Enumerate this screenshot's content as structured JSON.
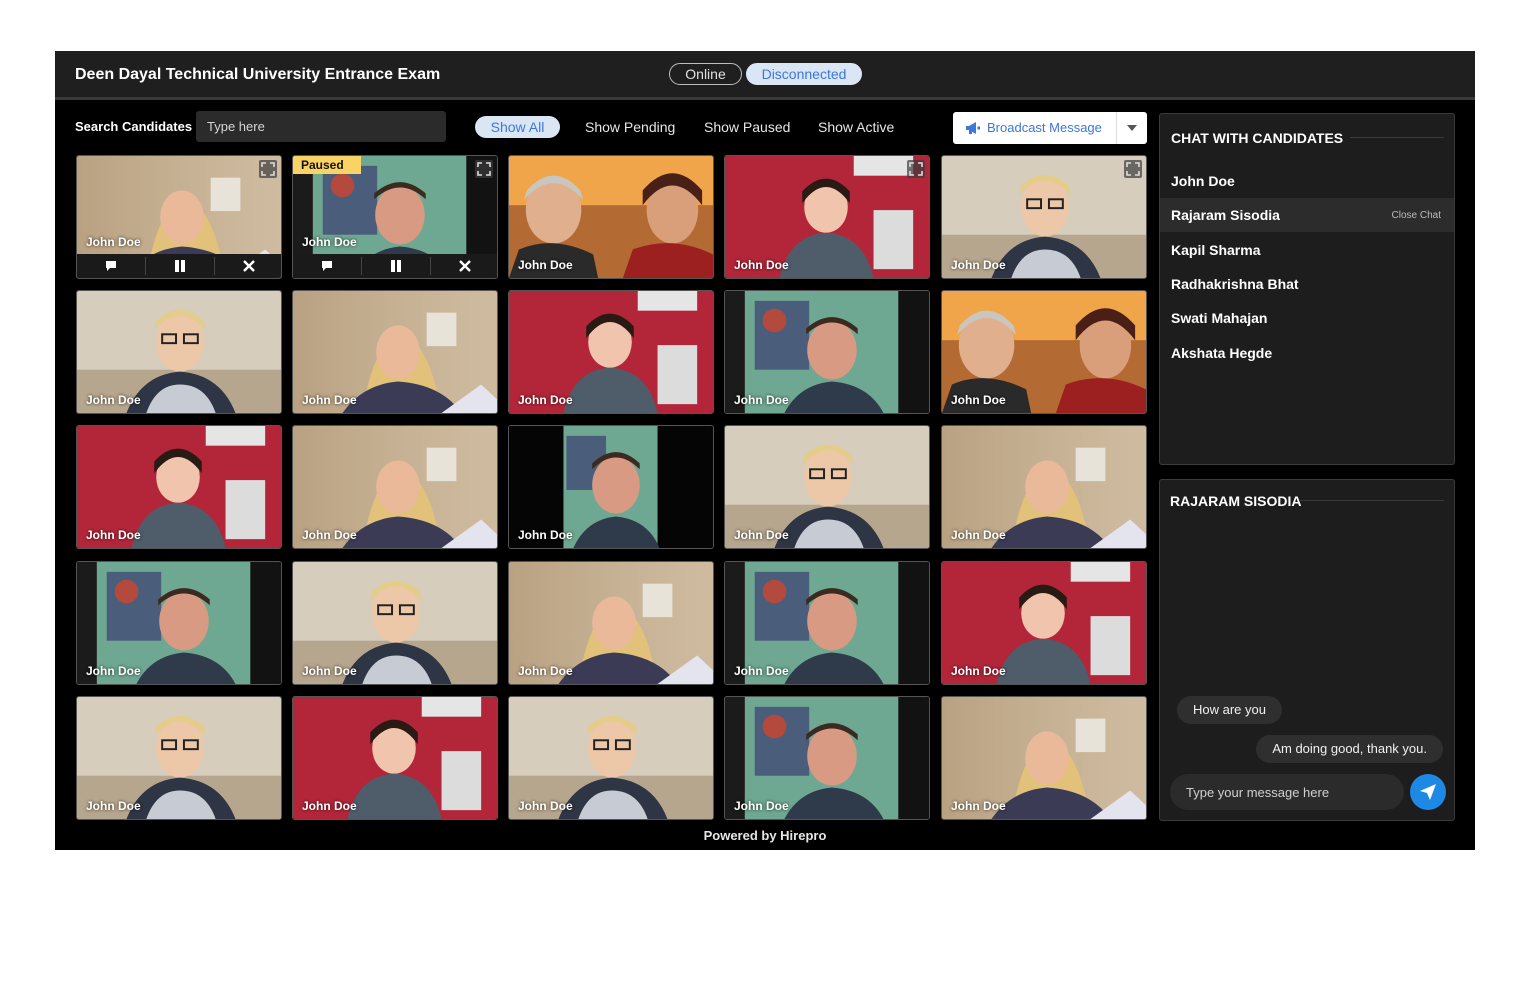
{
  "header": {
    "title": "Deen Dayal Technical University Entrance Exam",
    "status_online": "Online",
    "status_disconnected": "Disconnected"
  },
  "toolbar": {
    "search_label": "Search Candidates",
    "search_placeholder": "Type here",
    "filters": [
      "Show All",
      "Show Pending",
      "Show Paused",
      "Show Active"
    ],
    "broadcast_label": "Broadcast Message"
  },
  "grid": {
    "paused_label": "Paused",
    "tiles": [
      {
        "name": "John Doe",
        "scene": "blonde"
      },
      {
        "name": "John Doe",
        "scene": "green",
        "paused": true
      },
      {
        "name": "John Doe",
        "scene": "orange"
      },
      {
        "name": "John Doe",
        "scene": "red"
      },
      {
        "name": "John Doe",
        "scene": "glasses"
      },
      {
        "name": "John Doe",
        "scene": "glasses"
      },
      {
        "name": "John Doe",
        "scene": "blonde"
      },
      {
        "name": "John Doe",
        "scene": "red"
      },
      {
        "name": "John Doe",
        "scene": "green"
      },
      {
        "name": "John Doe",
        "scene": "orange"
      },
      {
        "name": "John Doe",
        "scene": "red"
      },
      {
        "name": "John Doe",
        "scene": "blonde"
      },
      {
        "name": "John Doe",
        "scene": "dark"
      },
      {
        "name": "John Doe",
        "scene": "glasses"
      },
      {
        "name": "John Doe",
        "scene": "blonde"
      },
      {
        "name": "John Doe",
        "scene": "green"
      },
      {
        "name": "John Doe",
        "scene": "glasses"
      },
      {
        "name": "John Doe",
        "scene": "blonde"
      },
      {
        "name": "John Doe",
        "scene": "green"
      },
      {
        "name": "John Doe",
        "scene": "red"
      },
      {
        "name": "John Doe",
        "scene": "glasses"
      },
      {
        "name": "John Doe",
        "scene": "red"
      },
      {
        "name": "John Doe",
        "scene": "glasses"
      },
      {
        "name": "John Doe",
        "scene": "green"
      },
      {
        "name": "John Doe",
        "scene": "blonde"
      }
    ]
  },
  "chat_list": {
    "title": "CHAT WITH CANDIDATES",
    "close_label": "Close Chat",
    "selected": 1,
    "candidates": [
      "John Doe",
      "Rajaram Sisodia",
      "Kapil Sharma",
      "Radhakrishna Bhat",
      "Swati Mahajan",
      "Akshata Hegde"
    ]
  },
  "conversation": {
    "title": "RAJARAM SISODIA",
    "messages": [
      {
        "from": "them",
        "text": "How are you"
      },
      {
        "from": "me",
        "text": "Am doing good, thank you."
      }
    ],
    "input_placeholder": "Type your message here"
  },
  "footer": {
    "text": "Powered by Hirepro"
  },
  "colors": {
    "accent": "#3b78d8",
    "pill_bg": "#dbe6f5",
    "paused": "#f9d465",
    "send": "#1e88e5"
  }
}
